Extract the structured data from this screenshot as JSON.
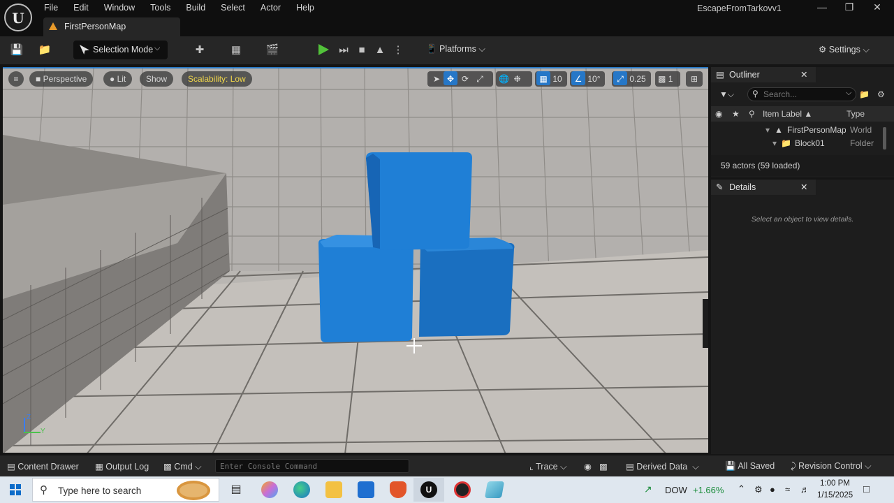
{
  "menu": [
    "File",
    "Edit",
    "Window",
    "Tools",
    "Build",
    "Select",
    "Actor",
    "Help"
  ],
  "project_name": "EscapeFromTarkovv1",
  "map_tab": "FirstPersonMap",
  "toolbar": {
    "selection_mode": "Selection Mode",
    "platforms": "Platforms",
    "settings": "Settings"
  },
  "viewport": {
    "perspective": "Perspective",
    "lit": "Lit",
    "show": "Show",
    "scalability": "Scalability: Low",
    "grid_snap": "10",
    "rotation_snap": "10°",
    "scale_snap": "0.25",
    "camera_speed": "1",
    "axis_z": "Z",
    "axis_y": "Y"
  },
  "outliner": {
    "title": "Outliner",
    "search_placeholder": "Search...",
    "col_label": "Item Label ▲",
    "col_type": "Type",
    "rows": [
      {
        "label": "FirstPersonMap",
        "type": "World"
      },
      {
        "label": "Block01",
        "type": "Folder"
      }
    ],
    "actors": "59 actors (59 loaded)"
  },
  "details": {
    "title": "Details",
    "empty": "Select an object to view details."
  },
  "statusbar": {
    "content_drawer": "Content Drawer",
    "output_log": "Output Log",
    "cmd": "Cmd",
    "console_placeholder": "Enter Console Command",
    "trace": "Trace",
    "derived_data": "Derived Data",
    "all_saved": "All Saved",
    "revision_control": "Revision Control"
  },
  "taskbar": {
    "search": "Type here to search",
    "stock_name": "DOW",
    "stock_change": "+1.66%",
    "time": "1:00 PM",
    "date": "1/15/2025"
  },
  "colors": {
    "accent": "#2677c7",
    "play": "#52c23a",
    "cube": "#1f7fd6",
    "scalability": "#f0d64a",
    "stock_up": "#1a8c3a"
  }
}
